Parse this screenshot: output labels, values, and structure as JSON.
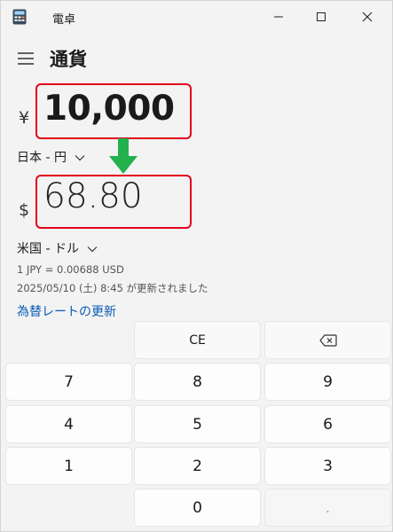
{
  "window": {
    "title": "電卓"
  },
  "header": {
    "mode": "通貨"
  },
  "from": {
    "symbol": "¥",
    "value": "10,000",
    "unit": "日本 - 円"
  },
  "to": {
    "symbol": "$",
    "value": "68.80",
    "unit": "米国 - ドル"
  },
  "info": {
    "rate": "1 JPY = 0.00688 USD",
    "updated": "2025/05/10 (土) 8:45 が更新されました",
    "update_link": "為替レートの更新"
  },
  "keypad": {
    "ce": "CE",
    "seven": "7",
    "eight": "8",
    "nine": "9",
    "four": "4",
    "five": "5",
    "six": "6",
    "one": "1",
    "two": "2",
    "three": "3",
    "zero": "0",
    "decimal": "."
  },
  "colors": {
    "highlight": "#e3001b",
    "arrow": "#22b14c",
    "link": "#0a5bb5"
  },
  "icons": {
    "app": "calculator-icon",
    "menu": "hamburger-icon",
    "backspace": "backspace-icon",
    "dropdown": "chevron-down-icon",
    "annotation": "down-arrow-icon"
  }
}
